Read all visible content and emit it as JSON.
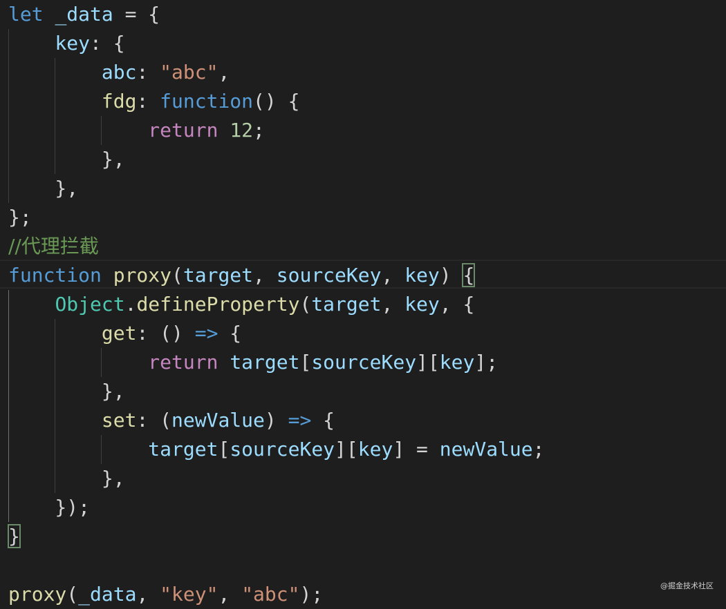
{
  "editor": {
    "comment": "//代理拦截",
    "watermark": "@掘金技术社区",
    "tokens": {
      "let": "let",
      "data": "_data",
      "key": "key",
      "abc": "abc",
      "abc_str": "\"abc\"",
      "fdg": "fdg",
      "function": "function",
      "return": "return",
      "twelve": "12",
      "proxy": "proxy",
      "target": "target",
      "sourceKey": "sourceKey",
      "Object": "Object",
      "defineProperty": "defineProperty",
      "get": "get",
      "set": "set",
      "newValue": "newValue",
      "key_str": "\"key\""
    }
  }
}
